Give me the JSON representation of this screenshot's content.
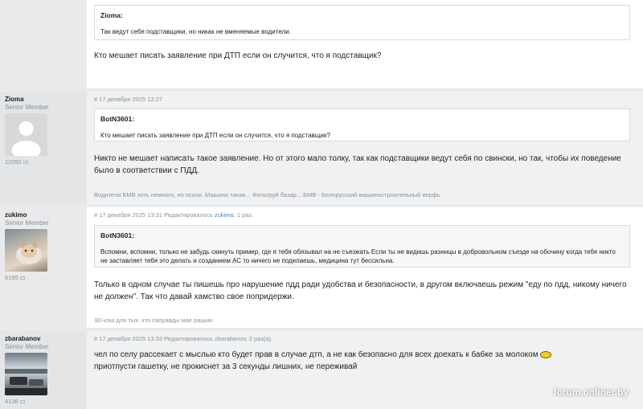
{
  "post0": {
    "quote_author": "Zioma:",
    "quote_text": "Так ведут себя подставщики, но никак не вменяемые водители.",
    "text": "Кто мешает писать заявление при ДТП если он случится, что я подставщик?"
  },
  "post1": {
    "author": "Zioma",
    "rank": "Senior Member",
    "count": "12092",
    "meta": "# 17 декабря 2025 13:27",
    "quote_author": "BotN3601:",
    "quote_text": "Кто мешает писать заявление при ДТП если он случится, что я подставщик?",
    "text": "Никто не мешает написать такое заявление. Но от этого мало толку, так как подставщики ведут себя по свински, но так, чтобы их поведение было в соответствии с ПДД.",
    "signature": "Водители БМВ хоть немного, но психи. Машина такая... Фильтруй базар... БМВ - Белорусский машиностроительный верфь"
  },
  "post2": {
    "author": "zukimo",
    "rank": "Senior Member",
    "count": "6185",
    "meta_prefix": "# 17 декабря 2025 13:31 Редактировалось ",
    "meta_editor": "zukimo",
    "meta_suffix": ", 1 раз.",
    "quote_author": "BotN3601:",
    "quote_text": "Вспомни, вспомни, только не забудь скинуть пример, где я тебя обязывал на не съезжать Если ты не видишь разницы в добровольном съезде на обочину когда тебя никто не заставляет тебя это делать и созданием АС то ничего не поделаешь, медицина тут бессильна.",
    "text": "Только в одном случае ты пишешь про нарушение пдд ради удобства и безопасности, в другом включаешь режим \"еду по пдд, никому ничего не должен\". Так что давай хамство свое попридержи.",
    "signature": "3D-кэш для тых, хто саправды мае рацыю"
  },
  "post3": {
    "author": "zbarabanov",
    "rank": "Senior Member",
    "count": "4136",
    "meta": "# 17 декабря 2025 13:33 Редактировалось zbarabanov, 2 раз(а).",
    "text_line1": "чел по селу рассекает с мыслью кто будет прав в случае дтп, а не как безопасно для всех доехать к бабке за молоком",
    "text_line2": "приотпусти гашетку, не прокиснет за 3 секунды лишних, не переживай"
  },
  "watermark": "forum.onliner.by"
}
